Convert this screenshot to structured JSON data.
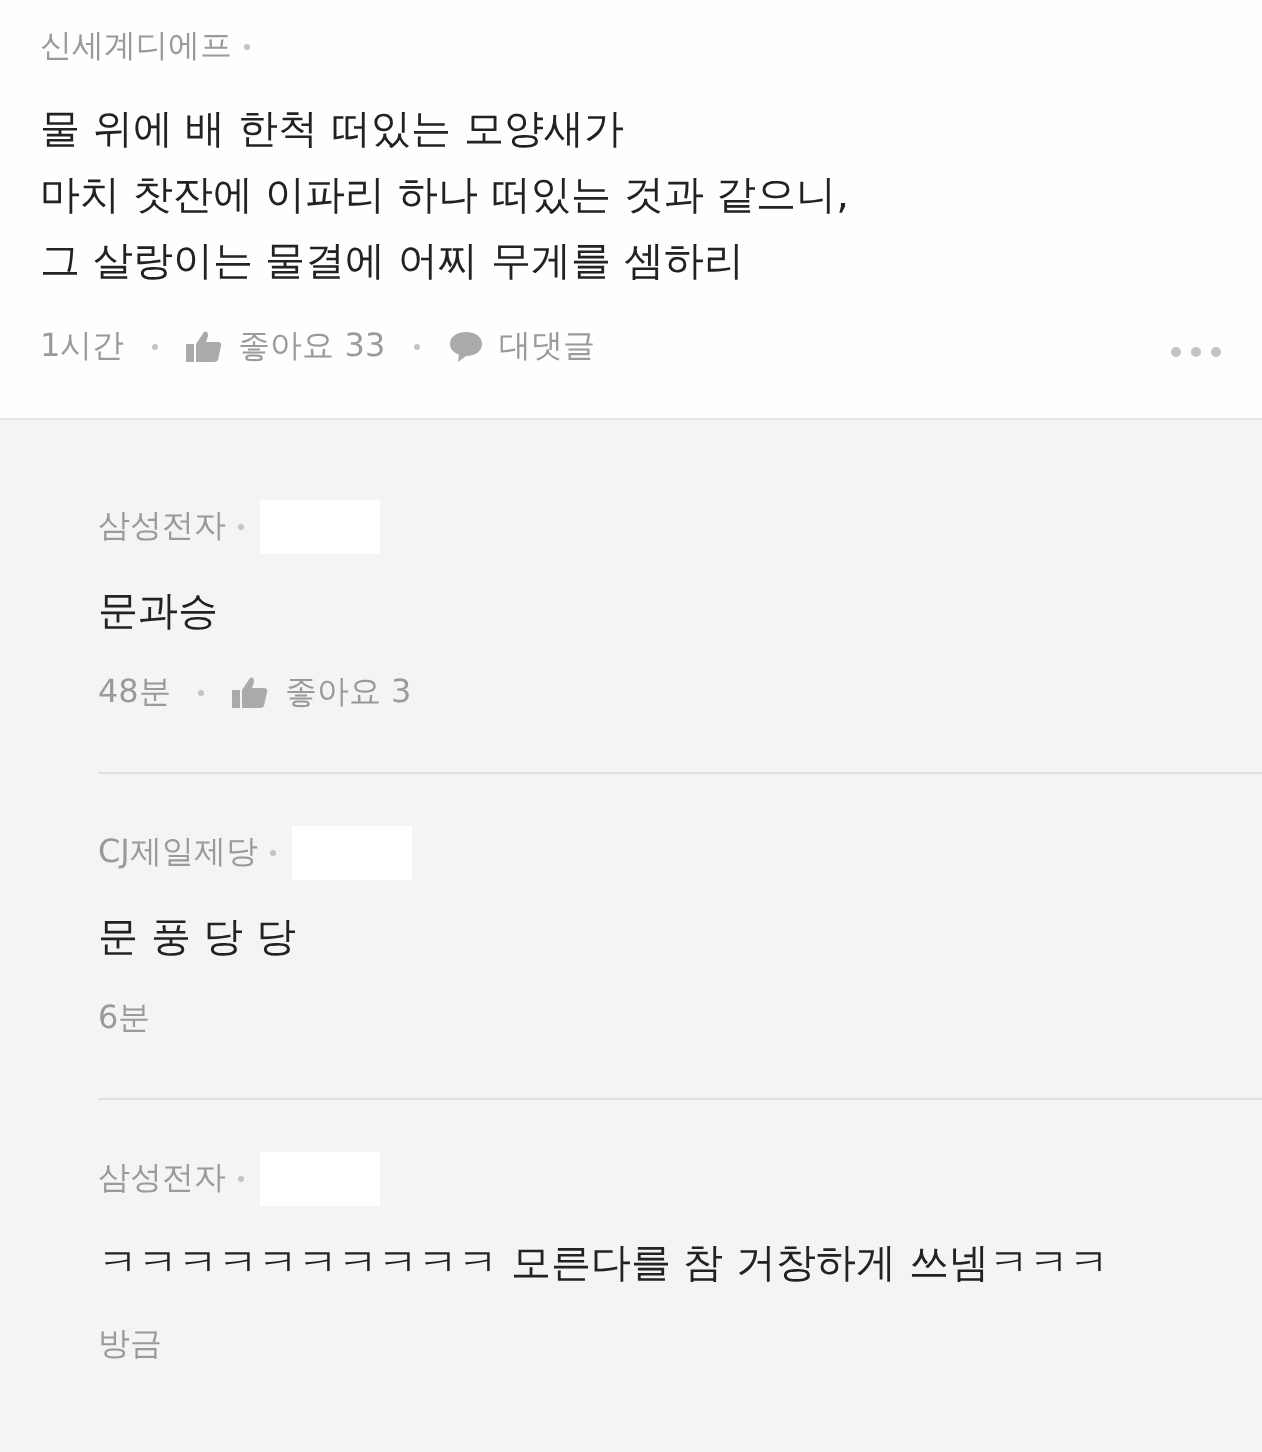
{
  "comment": {
    "author": "신세계디에프",
    "body_lines": [
      "물 위에 배 한척 떠있는 모양새가",
      "마치 찻잔에 이파리 하나 떠있는 것과 같으니,",
      "그 살랑이는 물결에 어찌 무게를 셈하리"
    ],
    "time": "1시간",
    "likes": "좋아요 33",
    "reply_label": "대댓글"
  },
  "replies": [
    {
      "author": "삼성전자",
      "redacted": true,
      "body": "문과승",
      "time": "48분",
      "likes": "좋아요 3"
    },
    {
      "author": "CJ제일제당",
      "redacted": true,
      "body": "문 풍 당 당",
      "time": "6분"
    },
    {
      "author": "삼성전자",
      "redacted": true,
      "body": "ㅋㅋㅋㅋㅋㅋㅋㅋㅋㅋ 모른다를 참 거창하게 쓰넴ㅋㅋㅋ",
      "time": "방금"
    }
  ]
}
